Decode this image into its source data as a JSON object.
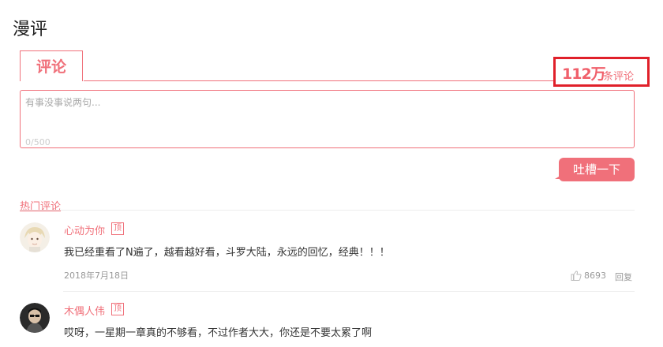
{
  "page": {
    "title": "漫评"
  },
  "tabs": {
    "comment_tab": "评论"
  },
  "count": {
    "number": "112万",
    "label": "条评论"
  },
  "input": {
    "placeholder": "有事没事说两句...",
    "counter": "0/500"
  },
  "submit": {
    "label": "吐槽一下"
  },
  "hot": {
    "title": "热门评论"
  },
  "comments": [
    {
      "user": "心动为你",
      "badge": "顶",
      "text": "我已经重看了N遍了，越看越好看，斗罗大陆，永远的回忆，经典！！！",
      "date": "2018年7月18日",
      "likes": "8693",
      "reply": "回复"
    },
    {
      "user": "木偶人伟",
      "badge": "顶",
      "text": "哎呀，一星期一章真的不够看，不过作者大大，你还是不要太累了啊"
    }
  ],
  "colors": {
    "accent": "#f0707a",
    "highlight_border": "#e0202a"
  }
}
